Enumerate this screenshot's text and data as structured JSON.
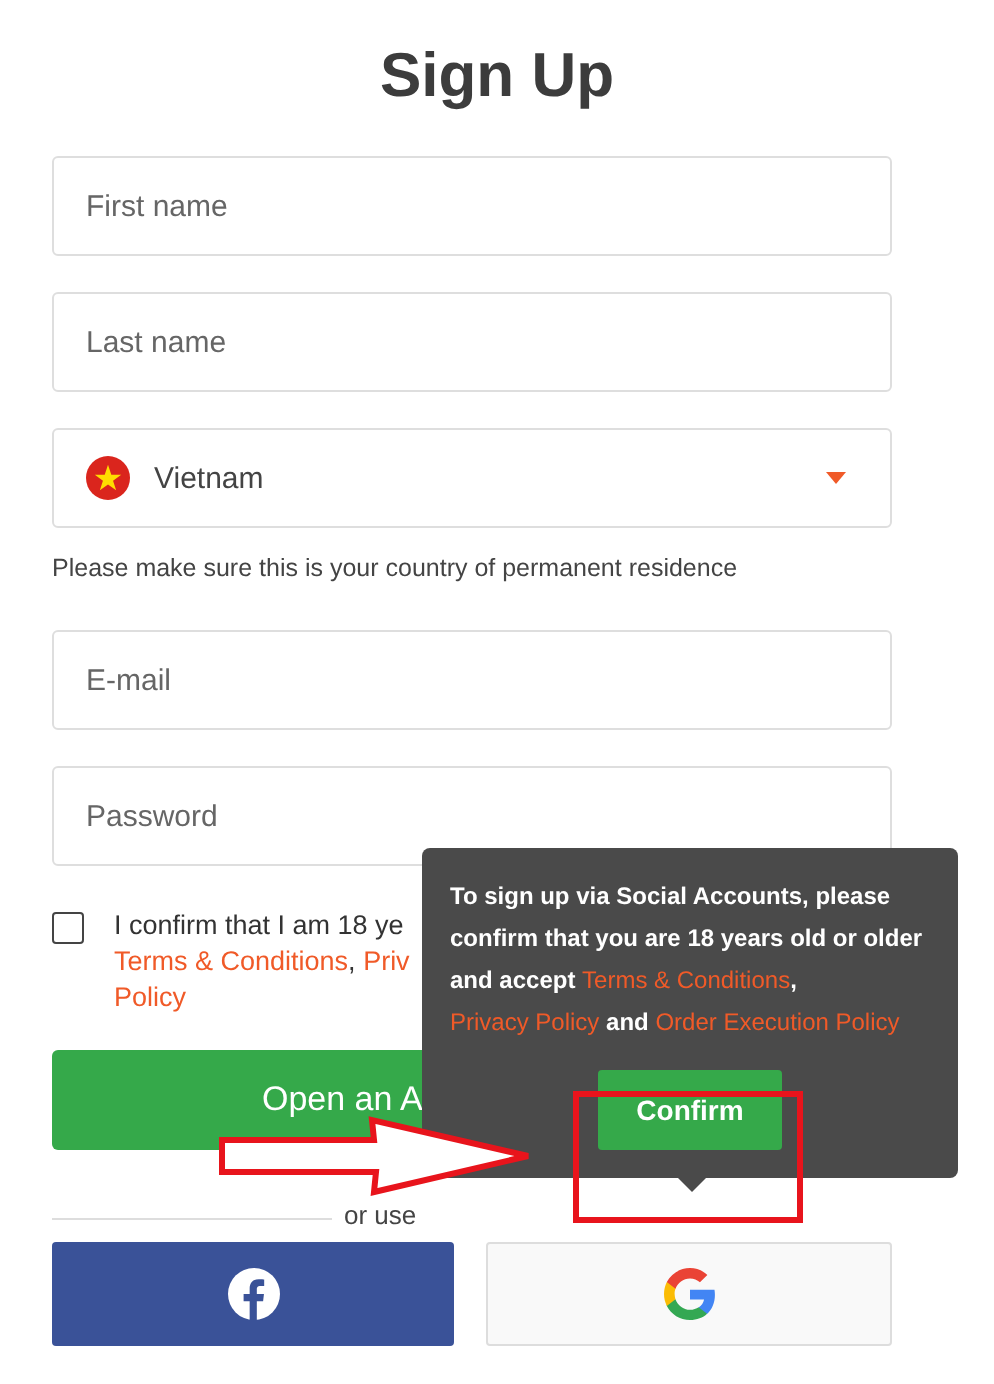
{
  "title": "Sign Up",
  "fields": [
    {
      "kind": "text",
      "placeholder": "First name"
    },
    {
      "kind": "text",
      "placeholder": "Last name"
    },
    {
      "kind": "country",
      "value": "Vietnam"
    },
    {
      "kind": "note",
      "text": "Please make sure this is your country of permanent residence"
    },
    {
      "kind": "text",
      "placeholder": "E-mail"
    },
    {
      "kind": "password",
      "placeholder": "Password"
    }
  ],
  "agreement": {
    "checked": false,
    "lines": [
      [
        {
          "kind": "plain",
          "text": "I confirm that I am 18 ye"
        }
      ],
      [
        {
          "kind": "link",
          "text": "Terms & Conditions"
        },
        {
          "kind": "plain",
          "text": ", "
        },
        {
          "kind": "link",
          "text": "Priv"
        }
      ],
      [
        {
          "kind": "link",
          "text": "Policy"
        }
      ]
    ]
  },
  "submit": "Open an A",
  "divider": "or use",
  "social": [
    {
      "kind": "facebook"
    },
    {
      "kind": "google"
    }
  ],
  "tooltip": {
    "parts": [
      {
        "kind": "plain",
        "text": "To sign up via Social Accounts, please confirm that you are 18 years old or older and accept "
      },
      {
        "kind": "link",
        "text": "Terms & Conditions"
      },
      {
        "kind": "plain",
        "text": ", "
      },
      {
        "kind": "link",
        "text": "Privacy Policy"
      },
      {
        "kind": "plain",
        "text": " and "
      },
      {
        "kind": "link",
        "text": "Order Execution Policy"
      }
    ],
    "button": "Confirm"
  }
}
